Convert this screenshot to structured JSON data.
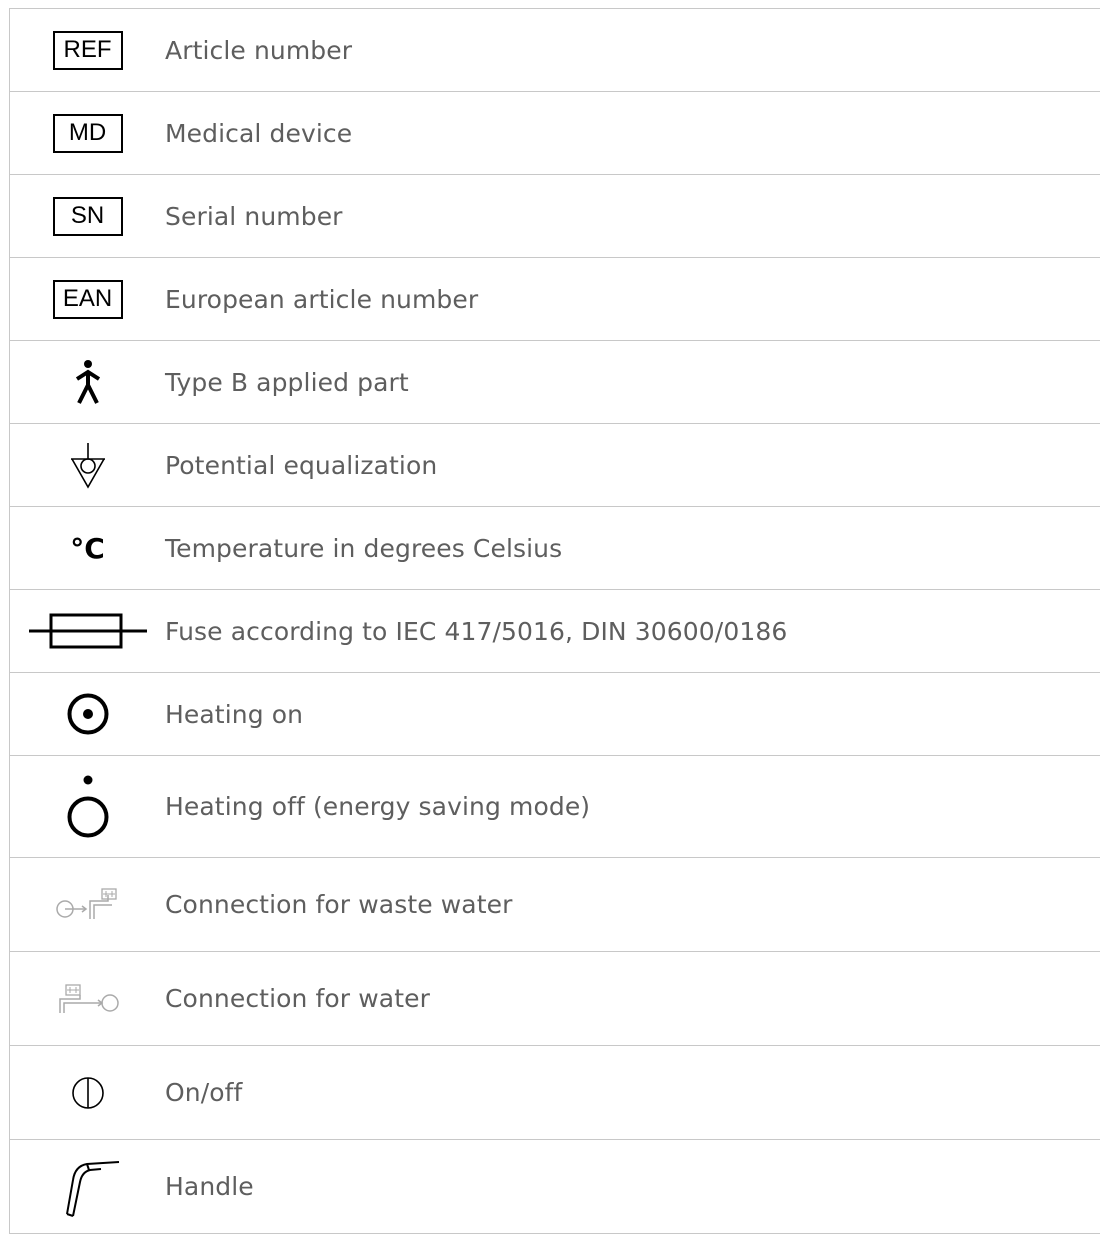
{
  "rows": [
    {
      "icon": "ref-box-icon",
      "symbol_text": "REF",
      "label": "Article number"
    },
    {
      "icon": "md-box-icon",
      "symbol_text": "MD",
      "label": "Medical device"
    },
    {
      "icon": "sn-box-icon",
      "symbol_text": "SN",
      "label": "Serial number"
    },
    {
      "icon": "ean-box-icon",
      "symbol_text": "EAN",
      "label": "European article number"
    },
    {
      "icon": "type-b-applied-part-icon",
      "label": "Type B applied part"
    },
    {
      "icon": "potential-equalization-icon",
      "label": "Potential equalization"
    },
    {
      "icon": "celsius-icon",
      "symbol_text": "°C",
      "label": "Temperature in degrees Celsius"
    },
    {
      "icon": "fuse-icon",
      "label": "Fuse according to IEC 417/5016, DIN 30600/0186"
    },
    {
      "icon": "heating-on-icon",
      "label": "Heating on"
    },
    {
      "icon": "heating-off-icon",
      "label": "Heating off (energy saving mode)"
    },
    {
      "icon": "waste-water-connection-icon",
      "label": "Connection for waste water"
    },
    {
      "icon": "water-connection-icon",
      "label": "Connection for water"
    },
    {
      "icon": "on-off-icon",
      "label": "On/off"
    },
    {
      "icon": "handle-icon",
      "label": "Handle"
    }
  ]
}
